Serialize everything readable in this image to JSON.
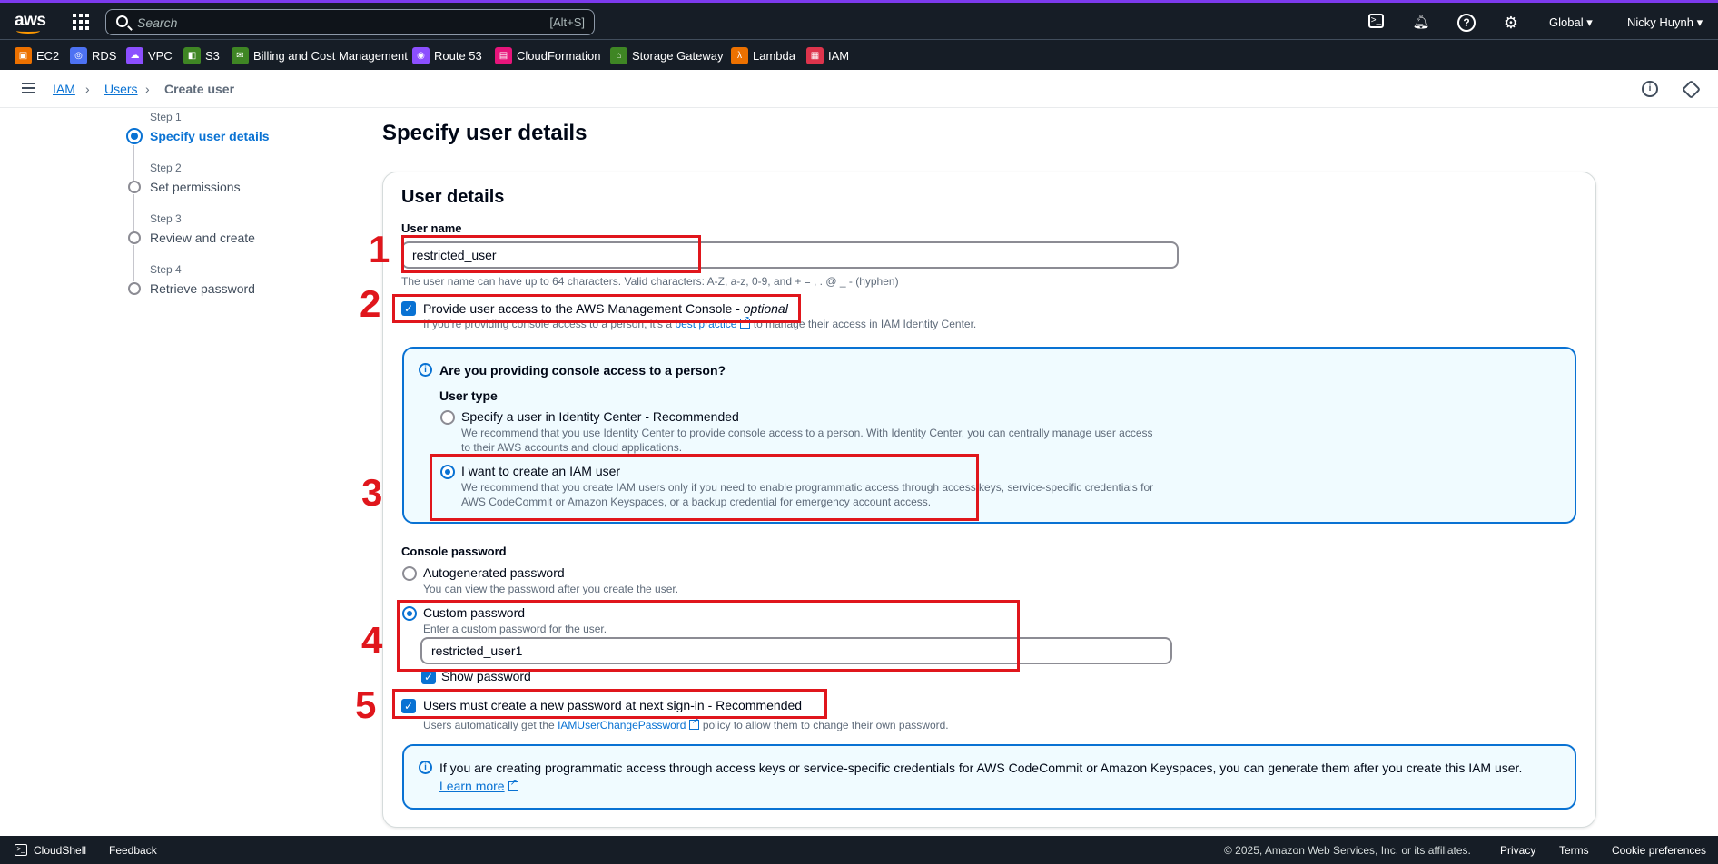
{
  "topnav": {
    "logo": "aws",
    "search_placeholder": "Search",
    "search_shortcut": "[Alt+S]",
    "region": "Global ▾",
    "user": "Nicky Huynh ▾"
  },
  "favorites": [
    {
      "label": "EC2",
      "color": "#ed7100"
    },
    {
      "label": "RDS",
      "color": "#4d72f3"
    },
    {
      "label": "VPC",
      "color": "#8c4fff"
    },
    {
      "label": "S3",
      "color": "#3f8624"
    },
    {
      "label": "Billing and Cost Management",
      "color": "#3f8624"
    },
    {
      "label": "Route 53",
      "color": "#8c4fff"
    },
    {
      "label": "CloudFormation",
      "color": "#e7157b"
    },
    {
      "label": "Storage Gateway",
      "color": "#3f8624"
    },
    {
      "label": "Lambda",
      "color": "#ed7100"
    },
    {
      "label": "IAM",
      "color": "#dd344c"
    }
  ],
  "breadcrumb": {
    "iam": "IAM",
    "users": "Users",
    "current": "Create user"
  },
  "steps": [
    {
      "label": "Step 1",
      "name": "Specify user details"
    },
    {
      "label": "Step 2",
      "name": "Set permissions"
    },
    {
      "label": "Step 3",
      "name": "Review and create"
    },
    {
      "label": "Step 4",
      "name": "Retrieve password"
    }
  ],
  "page_title": "Specify user details",
  "card": {
    "title": "User details",
    "username_label": "User name",
    "username_value": "restricted_user",
    "username_hint": "The user name can have up to 64 characters. Valid characters: A-Z, a-z, 0-9, and + = , . @ _ - (hyphen)",
    "console_access_label": "Provide user access to the AWS Management Console - ",
    "console_access_optional": "optional",
    "console_access_hint_pre": "If you're providing console access to a person, it's a ",
    "console_access_hint_link": "best practice",
    "console_access_hint_post": " to manage their access in IAM Identity Center.",
    "person_question": "Are you providing console access to a person?",
    "user_type_label": "User type",
    "opt_identity_center": "Specify a user in Identity Center - Recommended",
    "opt_identity_center_desc1": "We recommend that you use Identity Center to provide console access to a person. With Identity Center, you can centrally manage user access",
    "opt_identity_center_desc2": "to their AWS accounts and cloud applications.",
    "opt_iam_user": "I want to create an IAM user",
    "opt_iam_user_desc1": "We recommend that you create IAM users only if you need to enable programmatic access through access keys, service-specific credentials for",
    "opt_iam_user_desc2": "AWS CodeCommit or Amazon Keyspaces, or a backup credential for emergency account access.",
    "console_password_label": "Console password",
    "opt_autogen": "Autogenerated password",
    "opt_autogen_desc": "You can view the password after you create the user.",
    "opt_custom": "Custom password",
    "opt_custom_desc": "Enter a custom password for the user.",
    "custom_password_value": "restricted_user1",
    "show_password": "Show password",
    "must_reset": "Users must create a new password at next sign-in - Recommended",
    "must_reset_hint_pre": "Users automatically get the ",
    "must_reset_hint_link": "IAMUserChangePassword",
    "must_reset_hint_post": " policy to allow them to change their own password.",
    "info_text": "If you are creating programmatic access through access keys or service-specific credentials for AWS CodeCommit or Amazon Keyspaces, you can generate them after you create this IAM user.",
    "learn_more": "Learn more"
  },
  "annotations": [
    "1",
    "2",
    "3",
    "4",
    "5"
  ],
  "footer": {
    "cloudshell": "CloudShell",
    "feedback": "Feedback",
    "copyright": "© 2025, Amazon Web Services, Inc. or its affiliates.",
    "privacy": "Privacy",
    "terms": "Terms",
    "cookies": "Cookie preferences"
  }
}
